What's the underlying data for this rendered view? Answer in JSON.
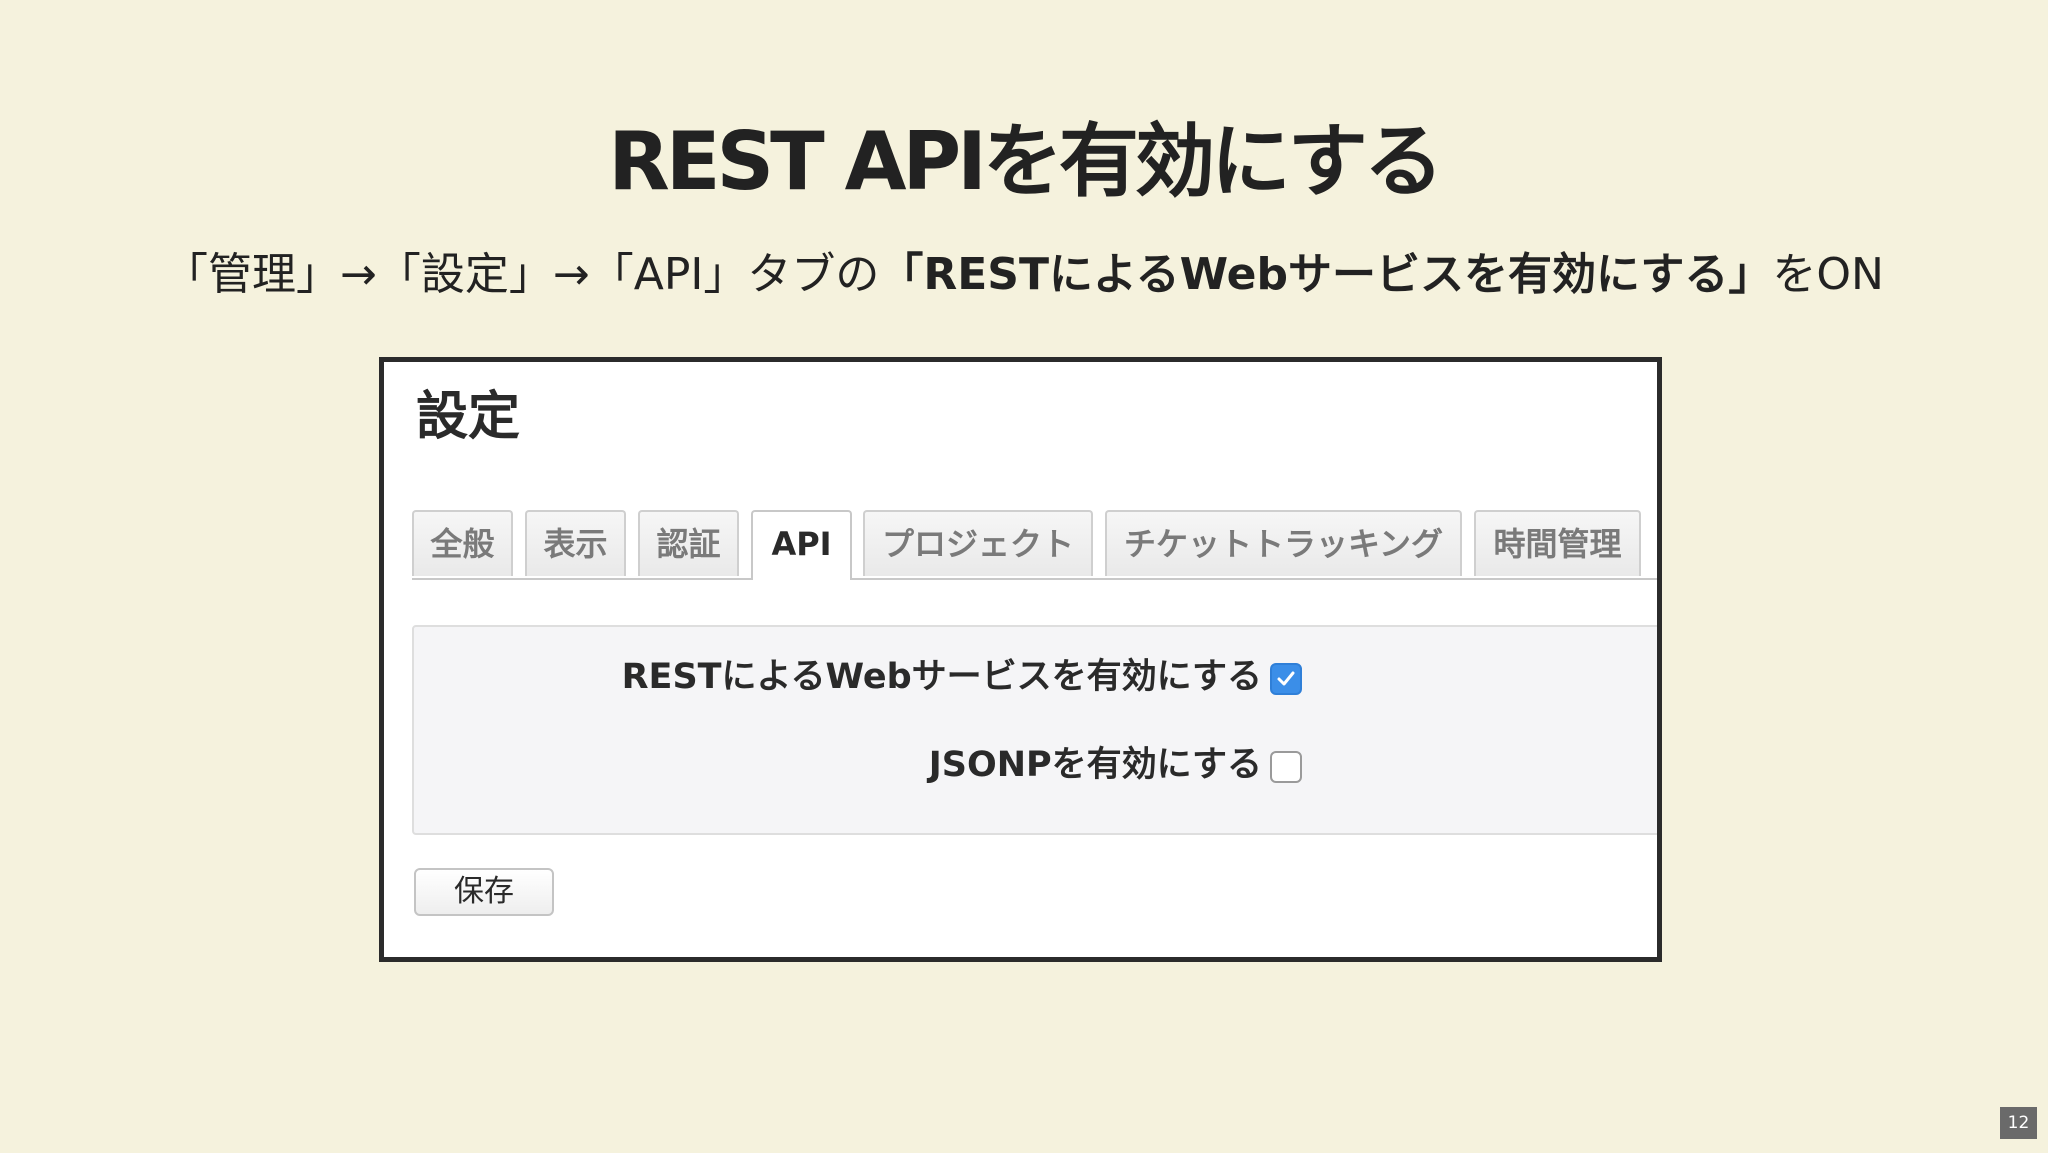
{
  "slide": {
    "title": "REST APIを有効にする",
    "instruction_prefix": "「管理」→「設定」→「API」タブの",
    "instruction_emphasis": "「RESTによるWebサービスを有効にする」",
    "instruction_suffix": "をON",
    "page_number": "12"
  },
  "panel": {
    "title": "設定",
    "tabs": [
      {
        "label": "全般",
        "active": false
      },
      {
        "label": "表示",
        "active": false
      },
      {
        "label": "認証",
        "active": false
      },
      {
        "label": "API",
        "active": true
      },
      {
        "label": "プロジェクト",
        "active": false
      },
      {
        "label": "チケットトラッキング",
        "active": false
      },
      {
        "label": "時間管理",
        "active": false
      }
    ],
    "settings": [
      {
        "label": "RESTによるWebサービスを有効にする",
        "checked": true
      },
      {
        "label": "JSONPを有効にする",
        "checked": false
      }
    ],
    "save_label": "保存"
  },
  "colors": {
    "background": "#f5f2dd",
    "checkbox_accent": "#3b8ee8"
  }
}
